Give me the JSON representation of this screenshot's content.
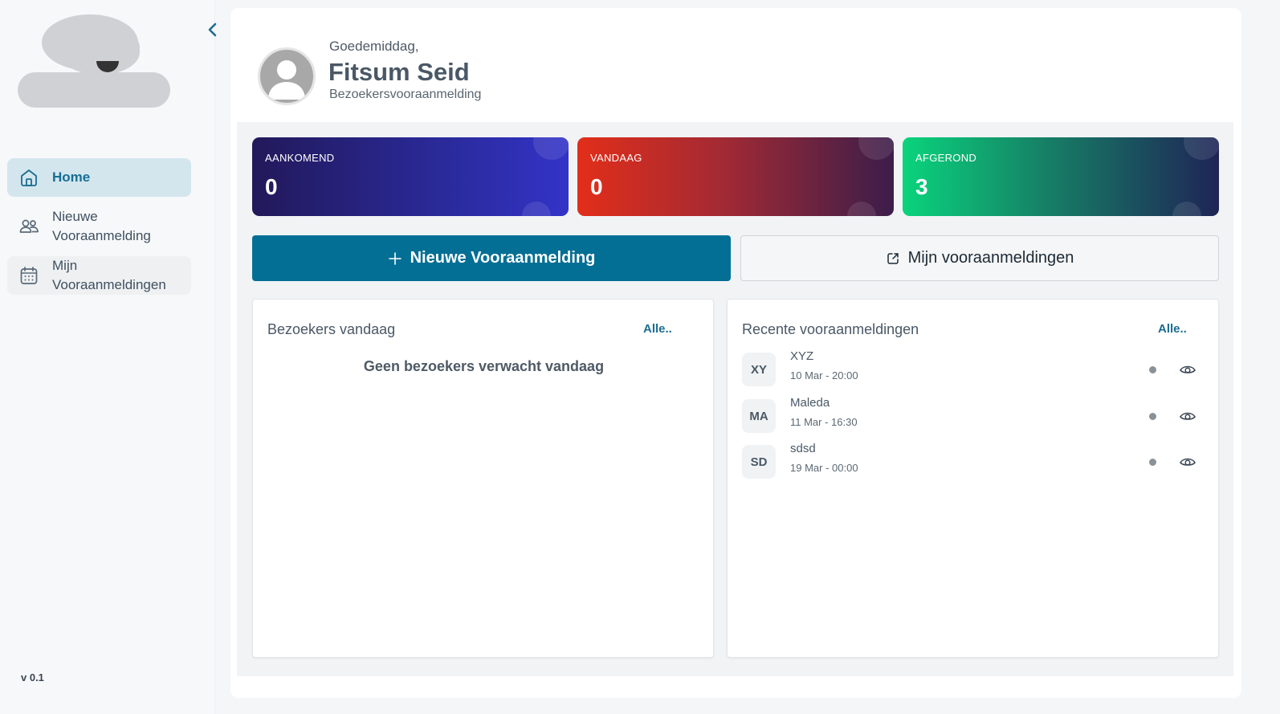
{
  "sidebar": {
    "items": [
      {
        "label": "Home",
        "icon": "home-icon",
        "active": true
      },
      {
        "label_line1": "Nieuwe",
        "label_line2": "Vooraanmelding",
        "icon": "users-icon"
      },
      {
        "label_line1": "Mijn",
        "label_line2": "Vooraanmeldingen",
        "icon": "calendar-icon"
      }
    ],
    "version": "v 0.1",
    "collapse_icon": "chevron-left-icon"
  },
  "header": {
    "greeting": "Goedemiddag,",
    "user_name": "Fitsum Seid",
    "subtitle": "Bezoekersvooraanmelding",
    "avatar_icon": "user-avatar-icon"
  },
  "stats": [
    {
      "label": "AANKOMEND",
      "value": "0"
    },
    {
      "label": "VANDAAG",
      "value": "0"
    },
    {
      "label": "AFGEROND",
      "value": "3"
    }
  ],
  "actions": {
    "primary_label": "Nieuwe Vooraanmelding",
    "primary_icon": "plus-icon",
    "secondary_label": "Mijn vooraanmeldingen",
    "secondary_icon": "external-link-icon"
  },
  "visitors_today": {
    "title": "Bezoekers vandaag",
    "link": "Alle..",
    "empty_message": "Geen bezoekers verwacht vandaag"
  },
  "recent": {
    "title": "Recente vooraanmeldingen",
    "link": "Alle..",
    "items": [
      {
        "initials": "XY",
        "name": "XYZ",
        "time": "10 Mar - 20:00"
      },
      {
        "initials": "MA",
        "name": "Maleda",
        "time": "11 Mar - 16:30"
      },
      {
        "initials": "SD",
        "name": "sdsd",
        "time": "19 Mar - 00:00"
      }
    ]
  },
  "colors": {
    "accent": "#046f95",
    "active_nav_bg": "#d3e6ee"
  }
}
